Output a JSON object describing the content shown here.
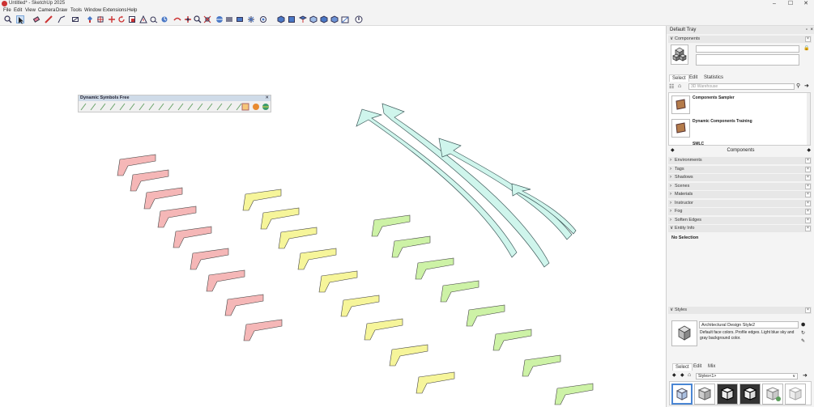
{
  "window": {
    "title": "Untitled* - SketchUp 2025",
    "minimize": "–",
    "maximize": "☐",
    "close": "✕"
  },
  "menu": [
    "File",
    "Edit",
    "View",
    "Camera",
    "Draw",
    "Tools",
    "Window",
    "Extensions",
    "Help"
  ],
  "toolbar_icons": [
    "search-icon",
    "select-icon",
    "eraser-icon",
    "pencil-icon",
    "line-icon",
    "rectangle-icon",
    "push-pull-icon",
    "move-icon",
    "rotate-icon",
    "scale-icon",
    "offset-icon",
    "tape-icon",
    "protractor-icon",
    "dimension-icon",
    "text-icon",
    "orbit-icon",
    "pan-icon",
    "zoom-icon",
    "zoom-extents-icon",
    "section-icon",
    "layers-icon",
    "components-icon",
    "styles-icon",
    "shadows-icon",
    "views-icon",
    "iso-icon",
    "top-icon",
    "front-icon",
    "right-icon",
    "back-icon",
    "left-icon",
    "warehouse-icon"
  ],
  "dynamic_toolbar": {
    "title": "Dynamic Symbols Free",
    "close": "✕"
  },
  "tray": {
    "title": "Default Tray",
    "components": {
      "label": "Components",
      "tabs": [
        "Select",
        "Edit",
        "Statistics"
      ],
      "search_placeholder": "3D Warehouse",
      "items": [
        "Components Sampler",
        "Dynamic Components Training",
        "SMLC"
      ],
      "footer": "Components"
    },
    "sections": [
      "Environments",
      "Tags",
      "Shadows",
      "Scenes",
      "Materials",
      "Instructor",
      "Fog",
      "Soften Edges"
    ],
    "entity_info": {
      "label": "Entity Info",
      "value": "No Selection"
    },
    "styles": {
      "label": "Styles",
      "name": "Architectural Design Style2",
      "description": "Default face colors. Profile edges. Light blue sky and gray background color.",
      "tabs": [
        "Select",
        "Edit",
        "Mix"
      ],
      "dropdown": "Styles<1>"
    }
  },
  "colors": {
    "red_face": "#f5b7b7",
    "yellow_face": "#f6f59a",
    "green_face": "#cdf2a6",
    "arrow_face": "#cff5ec"
  }
}
